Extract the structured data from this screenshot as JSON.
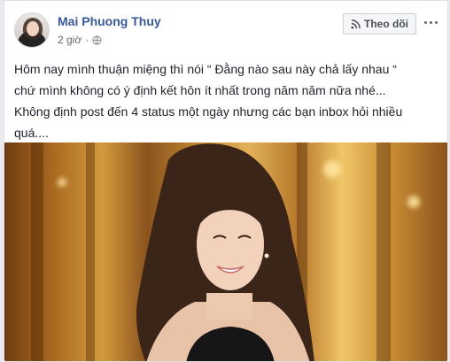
{
  "post": {
    "author_name": "Mai Phuong Thuy",
    "time": "2 giờ",
    "privacy_icon": "globe-icon",
    "follow_label": "Theo dõi",
    "follow_icon": "rss-icon",
    "more_icon": "more-options-icon",
    "text_lines": [
      "Hôm nay mình thuận miệng thì nói “ Đằng nào sau này chả lấy nhau “",
      "chứ mình không có ý định kết hôn ít nhất trong năm năm nữa nhé...",
      "Không định post đến 4 status một ngày nhưng các bạn inbox hỏi nhiều",
      "quá...."
    ]
  },
  "colors": {
    "author_link": "#385898",
    "text": "#1d2129",
    "meta": "#616770",
    "button_bg": "#f5f6f7",
    "border": "#dddfe2"
  }
}
